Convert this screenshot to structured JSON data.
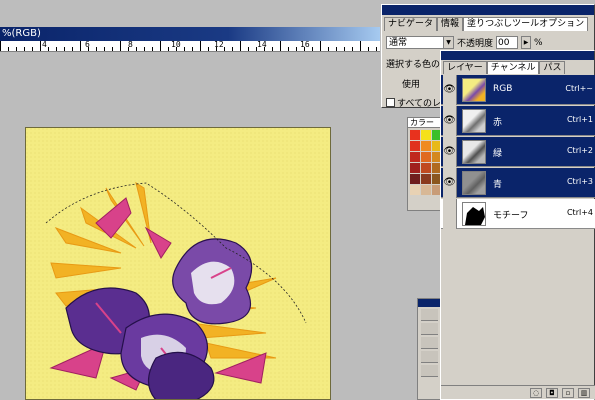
{
  "document": {
    "title": "%(RGB)",
    "ruler_numbers": [
      "4",
      "6",
      "8",
      "10",
      "12",
      "14",
      "16"
    ]
  },
  "options_palette": {
    "tabs": [
      {
        "label": "ナビゲータ",
        "active": false
      },
      {
        "label": "情報",
        "active": false
      },
      {
        "label": "塗りつぶしツールオプション",
        "active": true
      }
    ],
    "mode_value": "通常",
    "opacity_label": "不透明度",
    "opacity_value": "00",
    "opacity_unit": "%",
    "line2": "選択する色の",
    "line3": "使用",
    "line4": "すべてのレ"
  },
  "swatch_palette": {
    "tab_label": "カラー",
    "colors": [
      "#e8321e",
      "#f5e11a",
      "#3bbf2a",
      "#e0321e",
      "#f08a1e",
      "#e8b91a",
      "#c0281e",
      "#e06a1e",
      "#d4881e",
      "#a0201e",
      "#c04a1e",
      "#b06a1e",
      "#701e1e",
      "#8a3a1e",
      "#8a561e",
      "#e8d2b4",
      "#d8b896",
      "#c89c78"
    ]
  },
  "layers_palette": {
    "tabs": [
      {
        "label": "レイヤー",
        "active": false
      },
      {
        "label": "チャンネル",
        "active": true
      },
      {
        "label": "パス",
        "active": false
      }
    ],
    "channels": [
      {
        "name": "RGB",
        "shortcut": "Ctrl+~",
        "visible": true,
        "selected": true
      },
      {
        "name": "赤",
        "shortcut": "Ctrl+1",
        "visible": true,
        "selected": true
      },
      {
        "name": "緑",
        "shortcut": "Ctrl+2",
        "visible": true,
        "selected": true
      },
      {
        "name": "青",
        "shortcut": "Ctrl+3",
        "visible": true,
        "selected": true
      },
      {
        "name": "モチーフ",
        "shortcut": "Ctrl+4",
        "visible": false,
        "selected": false
      }
    ],
    "bottom_buttons": [
      "load-selection",
      "save-selection",
      "new-channel",
      "delete-channel"
    ]
  },
  "colors": {
    "titlebar": "#0a246a",
    "palette_bg": "#d4d0c8",
    "canvas_bg": "#f7ef86",
    "workspace": "#bcbcbc"
  }
}
